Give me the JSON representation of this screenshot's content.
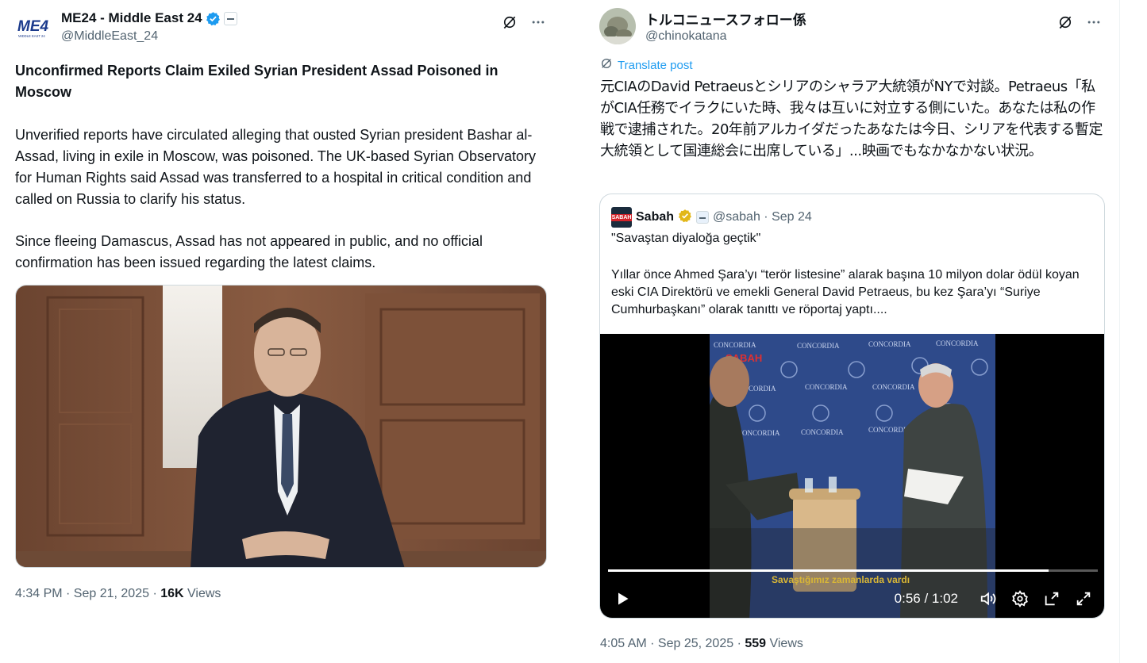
{
  "left_post": {
    "display_name": "ME24 - Middle East 24",
    "handle": "@MiddleEast_24",
    "avatar_text": "ME4",
    "avatar_subtext": "MIDDLE EAST 24",
    "headline": "Unconfirmed Reports Claim Exiled Syrian President Assad Poisoned in Moscow",
    "paragraph_1": "Unverified reports have circulated alleging that ousted Syrian president Bashar al-Assad, living in exile in Moscow, was poisoned. The UK-based Syrian Observatory for Human Rights said Assad was transferred to a hospital in critical condition and called on Russia to clarify his status.",
    "paragraph_2": "Since fleeing Damascus, Assad has not appeared in public, and no official confirmation has been issued regarding the latest claims.",
    "timestamp": "4:34 PM · Sep 21, 2025 · ",
    "views_count": "16K",
    "views_label": " Views"
  },
  "right_post": {
    "display_name": "トルコニュースフォロー係",
    "handle": "@chinokatana",
    "translate_label": "Translate post",
    "text": "元CIAのDavid Petraeusとシリアのシャラア大統領がNYで対談。Petraeus「私がCIA任務でイラクにいた時、我々は互いに対立する側にいた。あなたは私の作戦で逮捕された。20年前アルカイダだったあなたは今日、シリアを代表する暫定大統領として国連総会に出席している」...映画でもなかなかない状況。",
    "quote": {
      "avatar_text": "SABAH",
      "name": "Sabah",
      "handle_date": "@sabah · Sep 24",
      "line_1": "\"Savaştan diyaloğa geçtik\"",
      "line_2": "Yıllar önce Ahmed Şara’yı “terör listesine” alarak başına 10 milyon dolar ödül koyan eski CIA Direktörü ve emekli General David Petraeus, bu kez Şara’yı “Suriye Cumhurbaşkanı” olarak tanıttı ve röportaj yaptı....",
      "video": {
        "brand_overlay": "SABAH",
        "backdrop_text": "CONCORDIA",
        "subtitle": "Savaştığımız zamanlarda vardı",
        "time": "0:56 / 1:02",
        "progress": 0.9
      }
    },
    "timestamp": "4:05 AM · Sep 25, 2025 · ",
    "views_count": "559",
    "views_label": " Views"
  },
  "icons": [
    "grok-icon",
    "more-icon",
    "verified-icon",
    "affiliate-badge-icon",
    "translate-icon",
    "play-icon",
    "volume-icon",
    "settings-icon",
    "pip-icon",
    "fullscreen-icon",
    "gold-verified-icon"
  ],
  "colors": {
    "link_blue": "#1d9bf0",
    "verified_blue": "#1d9bf0",
    "gold": "#e2b719",
    "secondary_text": "#536471"
  }
}
